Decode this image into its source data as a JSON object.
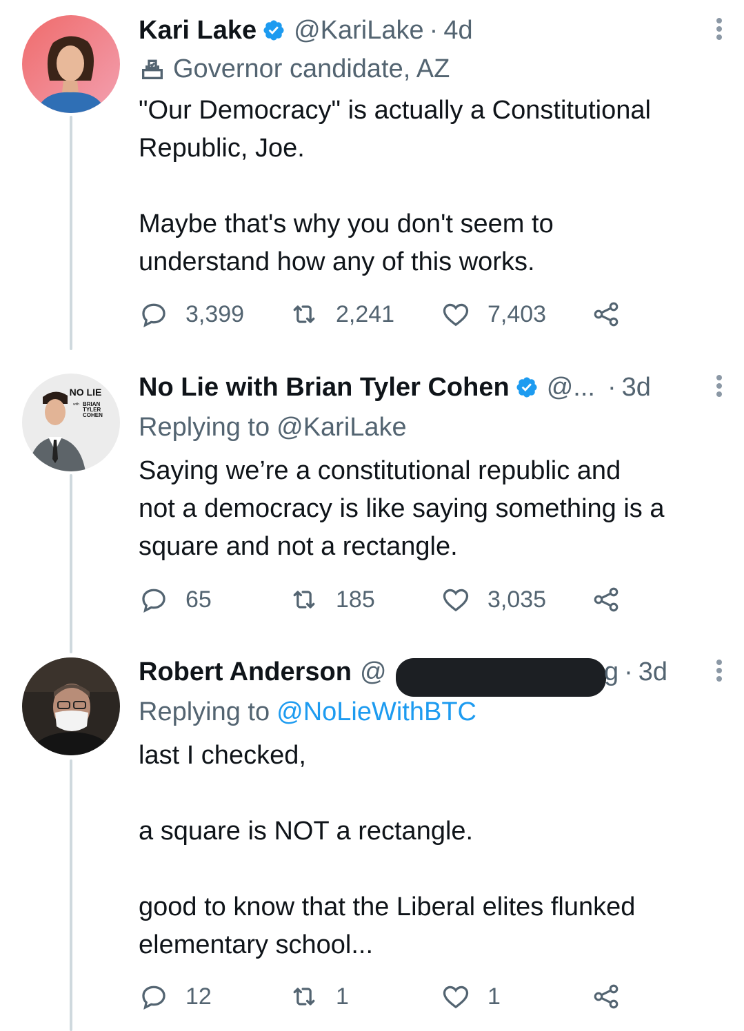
{
  "tweets": [
    {
      "name": "Kari Lake",
      "handle": "@KariLake",
      "time": "4d",
      "label": "Governor candidate, AZ",
      "body": [
        "\"Our Democracy\" is actually a Constitutional",
        "Republic, Joe.",
        "",
        "Maybe that's why you don't seem to",
        "understand how any of this works."
      ],
      "replies": "3,399",
      "retweets": "2,241",
      "likes": "7,403"
    },
    {
      "name": "No Lie with Brian Tyler Cohen",
      "handle": "@...",
      "time": "3d",
      "replying_prefix": "Replying to",
      "replying_to": "@KariLake",
      "body": [
        "Saying we’re a constitutional republic and",
        "not a democracy is like saying something is a",
        "square and not a rectangle."
      ],
      "replies": "65",
      "retweets": "185",
      "likes": "3,035",
      "avatar_text": {
        "line1": "NO LIE",
        "line2": "with",
        "line3": "BRIAN",
        "line4": "TYLER",
        "line5": "COHEN"
      }
    },
    {
      "name": "Robert Anderson",
      "handle_start": "@",
      "handle_end": "g",
      "time": "3d",
      "replying_prefix": "Replying to",
      "replying_to": "@NoLieWithBTC",
      "body": [
        "last I checked,",
        "",
        "a square is NOT a rectangle.",
        "",
        "good to know that the Liberal elites flunked",
        "elementary school..."
      ],
      "replies": "12",
      "retweets": "1",
      "likes": "1"
    }
  ],
  "separator": "·",
  "colors": {
    "text": "#0f1419",
    "secondary": "#536471",
    "link": "#1d9bf0",
    "verified": "#1d9bf0",
    "thread_line": "#cfd9de"
  },
  "icons": [
    "ballot-box-icon",
    "verified-badge-icon",
    "more-icon",
    "reply-icon",
    "retweet-icon",
    "like-icon",
    "share-icon"
  ]
}
